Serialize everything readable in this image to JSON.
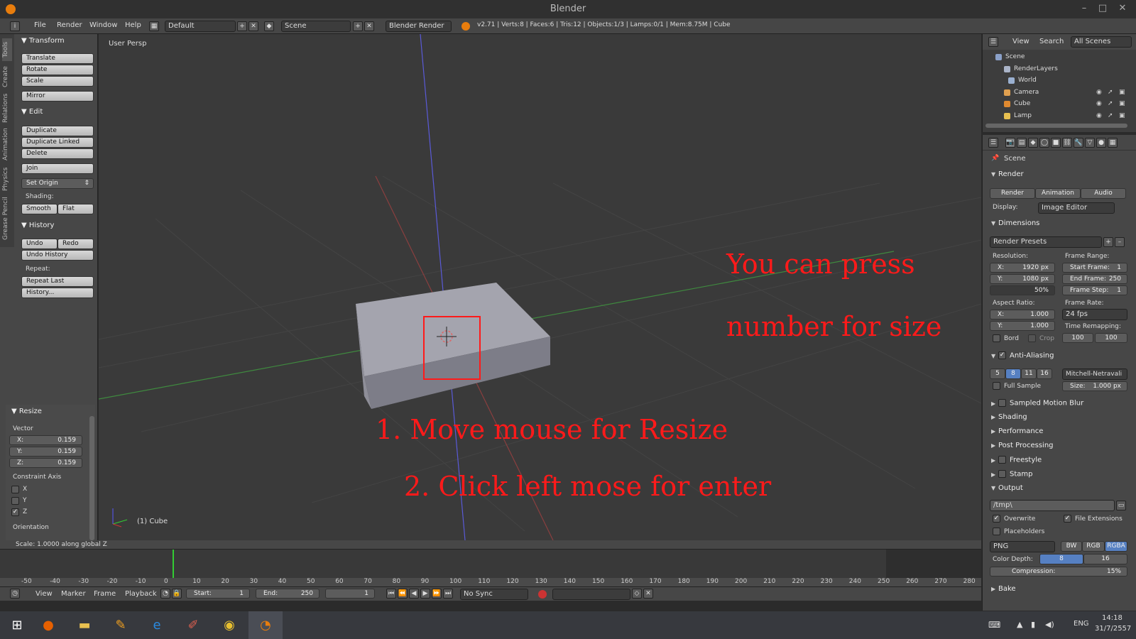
{
  "window": {
    "title": "Blender",
    "minimize": "–",
    "maximize": "□",
    "close": "✕"
  },
  "menubar": {
    "menus": [
      "File",
      "Render",
      "Window",
      "Help"
    ],
    "layout": "Default",
    "scene": "Scene",
    "engine": "Blender Render",
    "stats": "v2.71 | Verts:8 | Faces:6 | Tris:12 | Objects:1/3 | Lamps:0/1 | Mem:8.75M | Cube"
  },
  "toolshelf": {
    "tabs": [
      "Tools",
      "Create",
      "Relations",
      "Animation",
      "Physics",
      "Grease Pencil"
    ],
    "transform": {
      "title": "Transform",
      "buttons": [
        "Translate",
        "Rotate",
        "Scale",
        "Mirror"
      ]
    },
    "edit": {
      "title": "Edit",
      "buttons": [
        "Duplicate",
        "Duplicate Linked",
        "Delete",
        "Join"
      ],
      "set_origin": "Set Origin",
      "shading_label": "Shading:",
      "smooth": "Smooth",
      "flat": "Flat"
    },
    "history": {
      "title": "History",
      "undo": "Undo",
      "redo": "Redo",
      "undo_history": "Undo History",
      "repeat_label": "Repeat:",
      "repeat_last": "Repeat Last",
      "history_dots": "History..."
    },
    "resize": {
      "title": "Resize",
      "vector_label": "Vector",
      "x_label": "X:",
      "x": "0.159",
      "y_label": "Y:",
      "y": "0.159",
      "z_label": "Z:",
      "z": "0.159",
      "constraint_label": "Constraint Axis",
      "axes": [
        {
          "label": "X",
          "checked": false
        },
        {
          "label": "Y",
          "checked": false
        },
        {
          "label": "Z",
          "checked": true
        }
      ],
      "orientation_label": "Orientation"
    }
  },
  "viewport": {
    "view_label": "User Persp",
    "object_label": "(1) Cube",
    "annotations": {
      "line1": "You can press",
      "line2": "number for size",
      "step1": "1. Move mouse for Resize",
      "step2": "2. Click left mose for enter"
    }
  },
  "status": {
    "text": "Scale: 1.0000 along global Z"
  },
  "timeline": {
    "ticks": [
      "-50",
      "-40",
      "-30",
      "-20",
      "-10",
      "0",
      "10",
      "20",
      "30",
      "40",
      "50",
      "60",
      "70",
      "80",
      "90",
      "100",
      "110",
      "120",
      "130",
      "140",
      "150",
      "160",
      "170",
      "180",
      "190",
      "200",
      "210",
      "220",
      "230",
      "240",
      "250",
      "260",
      "270",
      "280"
    ],
    "menus": [
      "View",
      "Marker",
      "Frame",
      "Playback"
    ],
    "start_label": "Start:",
    "start": "1",
    "end_label": "End:",
    "end": "250",
    "current": "1",
    "sync": "No Sync"
  },
  "outliner": {
    "menus": [
      "View",
      "Search"
    ],
    "filter": "All Scenes",
    "items": [
      {
        "label": "Scene",
        "color": "#8aa0c8"
      },
      {
        "label": "RenderLayers",
        "color": "#aab4c8"
      },
      {
        "label": "World",
        "color": "#9ab0d0"
      },
      {
        "label": "Camera",
        "color": "#e0a050"
      },
      {
        "label": "Cube",
        "color": "#e08a30"
      },
      {
        "label": "Lamp",
        "color": "#e8c050"
      }
    ]
  },
  "properties": {
    "context": "Scene",
    "render": {
      "title": "Render",
      "render_btn": "Render",
      "animation_btn": "Animation",
      "audio_btn": "Audio",
      "display_label": "Display:",
      "display": "Image Editor"
    },
    "dimensions": {
      "title": "Dimensions",
      "presets": "Render Presets",
      "resolution_label": "Resolution:",
      "res_x_label": "X:",
      "res_x": "1920 px",
      "res_y_label": "Y:",
      "res_y": "1080 px",
      "res_pct": "50%",
      "frame_range_label": "Frame Range:",
      "start_label": "Start Frame:",
      "start": "1",
      "end_label": "End Frame:",
      "end": "250",
      "step_label": "Frame Step:",
      "step": "1",
      "aspect_label": "Aspect Ratio:",
      "asp_x_label": "X:",
      "asp_x": "1.000",
      "asp_y_label": "Y:",
      "asp_y": "1.000",
      "frame_rate_label": "Frame Rate:",
      "frame_rate": "24 fps",
      "time_remap_label": "Time Remapping:",
      "remap_old": "100",
      "remap_new": "100",
      "bord": "Bord",
      "crop": "Crop"
    },
    "aa": {
      "title": "Anti-Aliasing",
      "samples": [
        "5",
        "8",
        "11",
        "16"
      ],
      "active": "8",
      "filter": "Mitchell-Netravali",
      "full_sample": "Full Sample",
      "size_label": "Size:",
      "size": "1.000 px"
    },
    "collapsed": [
      "Sampled Motion Blur",
      "Shading",
      "Performance",
      "Post Processing",
      "Freestyle",
      "Stamp"
    ],
    "output": {
      "title": "Output",
      "path": "/tmp\\",
      "overwrite": "Overwrite",
      "file_ext": "File Extensions",
      "placeholders": "Placeholders",
      "format": "PNG",
      "bw": "BW",
      "rgb": "RGB",
      "rgba": "RGBA",
      "color_depth_label": "Color Depth:",
      "depth8": "8",
      "depth16": "16",
      "compression_label": "Compression:",
      "compression": "15%"
    },
    "bake": "Bake"
  },
  "taskbar": {
    "lang": "ENG",
    "time": "14:18",
    "date": "31/7/2557"
  }
}
